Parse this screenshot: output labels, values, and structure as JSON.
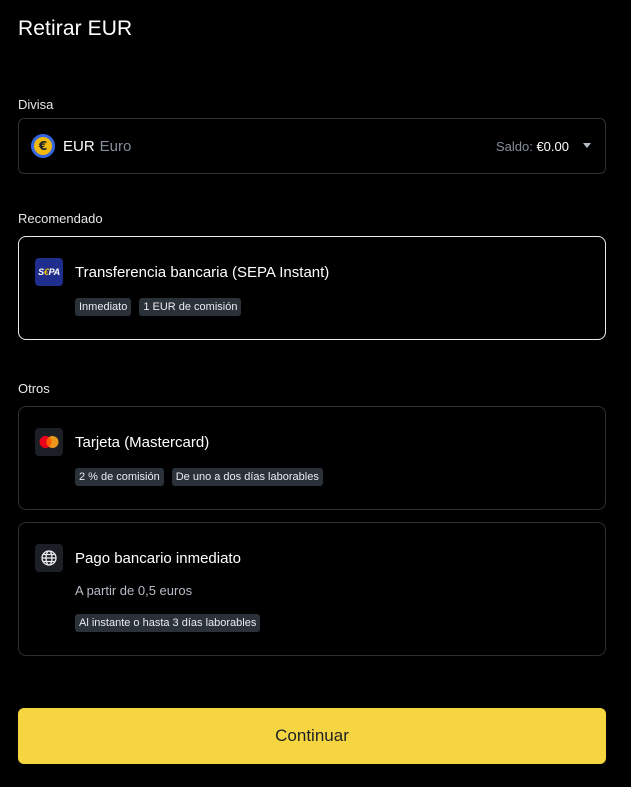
{
  "header": {
    "title": "Retirar EUR"
  },
  "currency": {
    "label": "Divisa",
    "code": "EUR",
    "name": "Euro",
    "symbol": "€",
    "balance_label": "Saldo",
    "balance_sep": ": ",
    "balance_value": "€0.00"
  },
  "recommended": {
    "label": "Recomendado",
    "method": {
      "icon_text_s": "S",
      "icon_text_e": "€",
      "icon_text_pa": "PA",
      "name": "Transferencia bancaria (SEPA Instant)",
      "tags": [
        "Inmediato",
        "1 EUR de comisión"
      ],
      "selected": true
    }
  },
  "others": {
    "label": "Otros",
    "methods": [
      {
        "name": "Tarjeta (Mastercard)",
        "tags": [
          "2 % de comisión",
          "De uno a dos días laborables"
        ]
      },
      {
        "name": "Pago bancario inmediato",
        "subtitle": "A partir de 0,5 euros",
        "tags": [
          "Al instante o hasta 3 días laborables"
        ]
      }
    ]
  },
  "actions": {
    "continue_label": "Continuar"
  },
  "colors": {
    "background": "#000000",
    "border": "#2b2f36",
    "selected_border": "#eaecef",
    "primary_button": "#f5d641",
    "tag_bg": "#2b3139"
  }
}
